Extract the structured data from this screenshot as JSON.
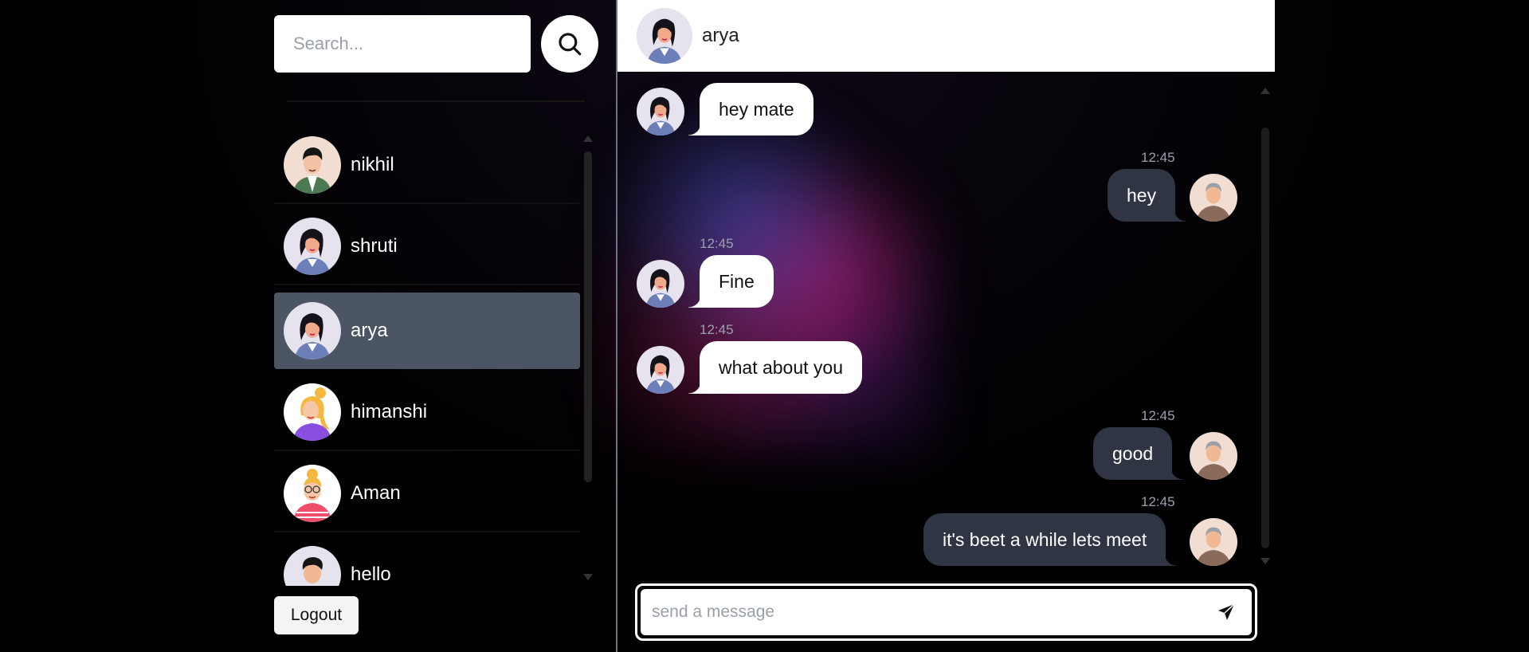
{
  "search": {
    "placeholder": "Search..."
  },
  "contacts": [
    {
      "name": "nikhil",
      "avatar": "avatar-man-green-shirt",
      "active": false
    },
    {
      "name": "shruti",
      "avatar": "avatar-woman-dark-hair",
      "active": false
    },
    {
      "name": "arya",
      "avatar": "avatar-woman-dark-hair",
      "active": true
    },
    {
      "name": "himanshi",
      "avatar": "avatar-woman-blonde-purple",
      "active": false
    },
    {
      "name": "Aman",
      "avatar": "avatar-woman-glasses-pink",
      "active": false
    },
    {
      "name": "hello",
      "avatar": "avatar-man-blue",
      "active": false
    }
  ],
  "logout_label": "Logout",
  "chat": {
    "contact_name": "arya",
    "messages": [
      {
        "direction": "in",
        "text": "hey mate",
        "time": ""
      },
      {
        "direction": "out",
        "text": "hey",
        "time": "12:45"
      },
      {
        "direction": "in",
        "text": "Fine",
        "time": "12:45"
      },
      {
        "direction": "in",
        "text": "what about you",
        "time": "12:45"
      },
      {
        "direction": "out",
        "text": "good",
        "time": "12:45"
      },
      {
        "direction": "out",
        "text": "it's beet a while lets meet",
        "time": "12:45"
      }
    ]
  },
  "composer": {
    "placeholder": "send a message"
  },
  "colors": {
    "active_item": "#4b5563",
    "outgoing_bubble": "#2f3542",
    "incoming_bubble": "#ffffff"
  }
}
